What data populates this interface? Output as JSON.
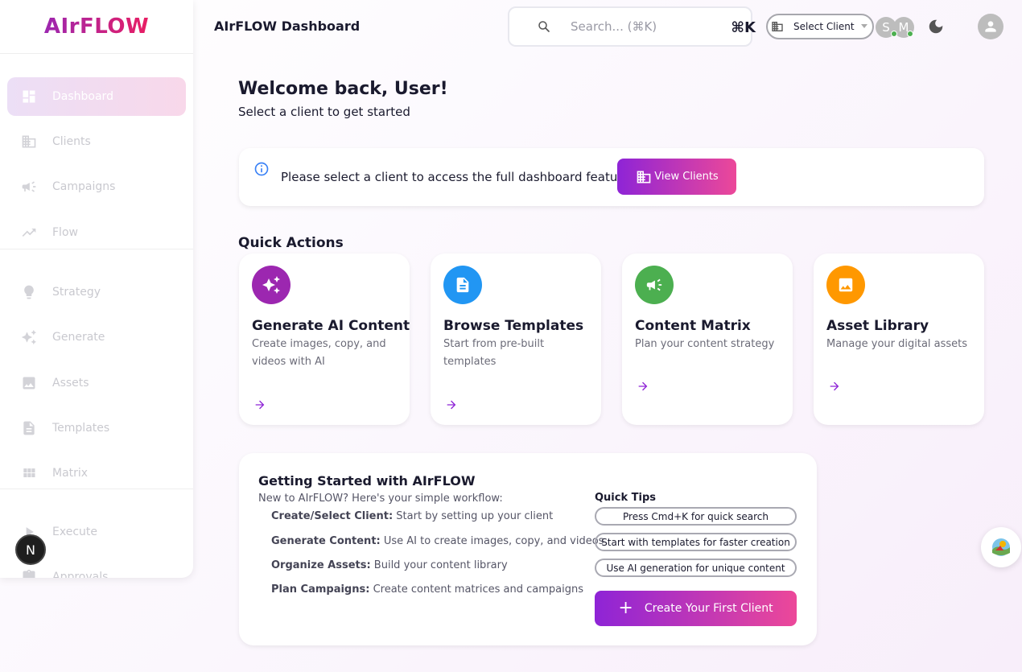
{
  "brand": {
    "logo": "AIrFLOW",
    "app_title": "AIrFLOW Dashboard"
  },
  "sidebar": {
    "items": [
      {
        "label": "Dashboard",
        "icon": "dashboard-icon",
        "active": true
      },
      {
        "label": "Clients",
        "icon": "building-icon"
      },
      {
        "label": "Campaigns",
        "icon": "megaphone-icon"
      },
      {
        "label": "Flow",
        "icon": "trending-icon"
      },
      {
        "label": "Strategy",
        "icon": "lightbulb-icon"
      },
      {
        "label": "Generate",
        "icon": "sparkle-icon"
      },
      {
        "label": "Assets",
        "icon": "image-icon"
      },
      {
        "label": "Templates",
        "icon": "document-icon"
      },
      {
        "label": "Matrix",
        "icon": "grid-icon"
      },
      {
        "label": "Execute",
        "icon": "play-icon"
      },
      {
        "label": "Approvals",
        "icon": "clipboard-icon"
      }
    ],
    "badge": "N"
  },
  "header": {
    "search_placeholder": "Search... (⌘K)",
    "shortcut": "⌘K",
    "client_select": "Select Client",
    "avatars": [
      "S",
      "M"
    ]
  },
  "welcome": {
    "title": "Welcome back, User!",
    "subtitle": "Select a client to get started"
  },
  "info": {
    "text": "Please select a client to access the full dashboard features",
    "button": "View Clients"
  },
  "quick_actions": {
    "title": "Quick Actions",
    "cards": [
      {
        "title": "Generate AI Content",
        "desc": "Create images, copy, and videos with AI",
        "color": "#9c27b0",
        "icon": "sparkle-icon"
      },
      {
        "title": "Browse Templates",
        "desc": "Start from pre-built templates",
        "color": "#2196f3",
        "icon": "document-icon"
      },
      {
        "title": "Content Matrix",
        "desc": "Plan your content strategy",
        "color": "#4caf50",
        "icon": "megaphone-icon"
      },
      {
        "title": "Asset Library",
        "desc": "Manage your digital assets",
        "color": "#ff9800",
        "icon": "image-icon"
      }
    ]
  },
  "getting_started": {
    "title": "Getting Started with AIrFLOW",
    "subtitle": "New to AIrFLOW? Here's your simple workflow:",
    "steps": [
      {
        "bold": "Create/Select Client:",
        "text": " Start by setting up your client"
      },
      {
        "bold": "Generate Content:",
        "text": " Use AI to create images, copy, and videos"
      },
      {
        "bold": "Organize Assets:",
        "text": " Build your content library"
      },
      {
        "bold": "Plan Campaigns:",
        "text": " Create content matrices and campaigns"
      }
    ],
    "tips_title": "Quick Tips",
    "tips": [
      "Press Cmd+K for quick search",
      "Start with templates for faster creation",
      "Use AI generation for unique content"
    ],
    "cta": "Create Your First Client"
  },
  "colors": {
    "accent_start": "#8e24d6",
    "accent_end": "#ec4899"
  }
}
